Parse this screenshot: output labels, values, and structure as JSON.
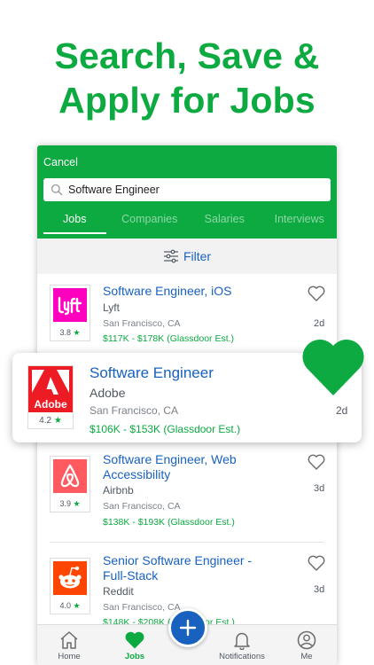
{
  "headline": {
    "line1": "Search, Save &",
    "line2": "Apply for Jobs"
  },
  "header": {
    "cancel_label": "Cancel",
    "search_value": "Software Engineer",
    "tabs": [
      {
        "label": "Jobs",
        "active": true
      },
      {
        "label": "Companies",
        "active": false
      },
      {
        "label": "Salaries",
        "active": false
      },
      {
        "label": "Interviews",
        "active": false
      }
    ]
  },
  "filter": {
    "label": "Filter"
  },
  "jobs": [
    {
      "title": "Software Engineer, iOS",
      "company": "Lyft",
      "location": "San Francisco, CA",
      "salary": "$117K - $178K (Glassdoor Est.)",
      "age": "2d",
      "rating": "3.8",
      "logo": "lyft-logo"
    },
    {
      "title": "Software Engineer, Web Accessibility",
      "title_line1": "Software Engineer, Web",
      "title_line2": "Accessibility",
      "company": "Airbnb",
      "location": "San Francisco, CA",
      "salary": "$138K - $193K (Glassdoor Est.)",
      "age": "3d",
      "rating": "3.9",
      "logo": "airbnb-logo"
    },
    {
      "title": "Senior Software Engineer - Full-Stack",
      "title_line1": "Senior Software Engineer -",
      "title_line2": "Full-Stack",
      "company": "Reddit",
      "location": "San Francisco, CA",
      "salary": "$148K - $208K (Glassdoor Est.)",
      "age": "3d",
      "rating": "4.0",
      "logo": "reddit-logo"
    }
  ],
  "featured_job": {
    "title": "Software Engineer",
    "company": "Adobe",
    "location": "San Francisco, CA",
    "salary": "$106K - $153K (Glassdoor Est.)",
    "age": "2d",
    "rating": "4.2",
    "logo": "adobe-logo",
    "logo_text": "Adobe",
    "saved": true
  },
  "nav": [
    {
      "label": "Home",
      "icon": "home-icon",
      "active": false
    },
    {
      "label": "Jobs",
      "icon": "heart-icon",
      "active": true
    },
    {
      "label": "Notifications",
      "icon": "bell-icon",
      "active": false
    },
    {
      "label": "Me",
      "icon": "profile-icon",
      "active": false
    }
  ],
  "colors": {
    "brand_green": "#0caa41",
    "link_blue": "#1861bf",
    "lyft_pink": "#ff00bf",
    "adobe_red": "#ed1c24",
    "airbnb_red": "#ff5a5f",
    "reddit_orange": "#ff4500"
  }
}
